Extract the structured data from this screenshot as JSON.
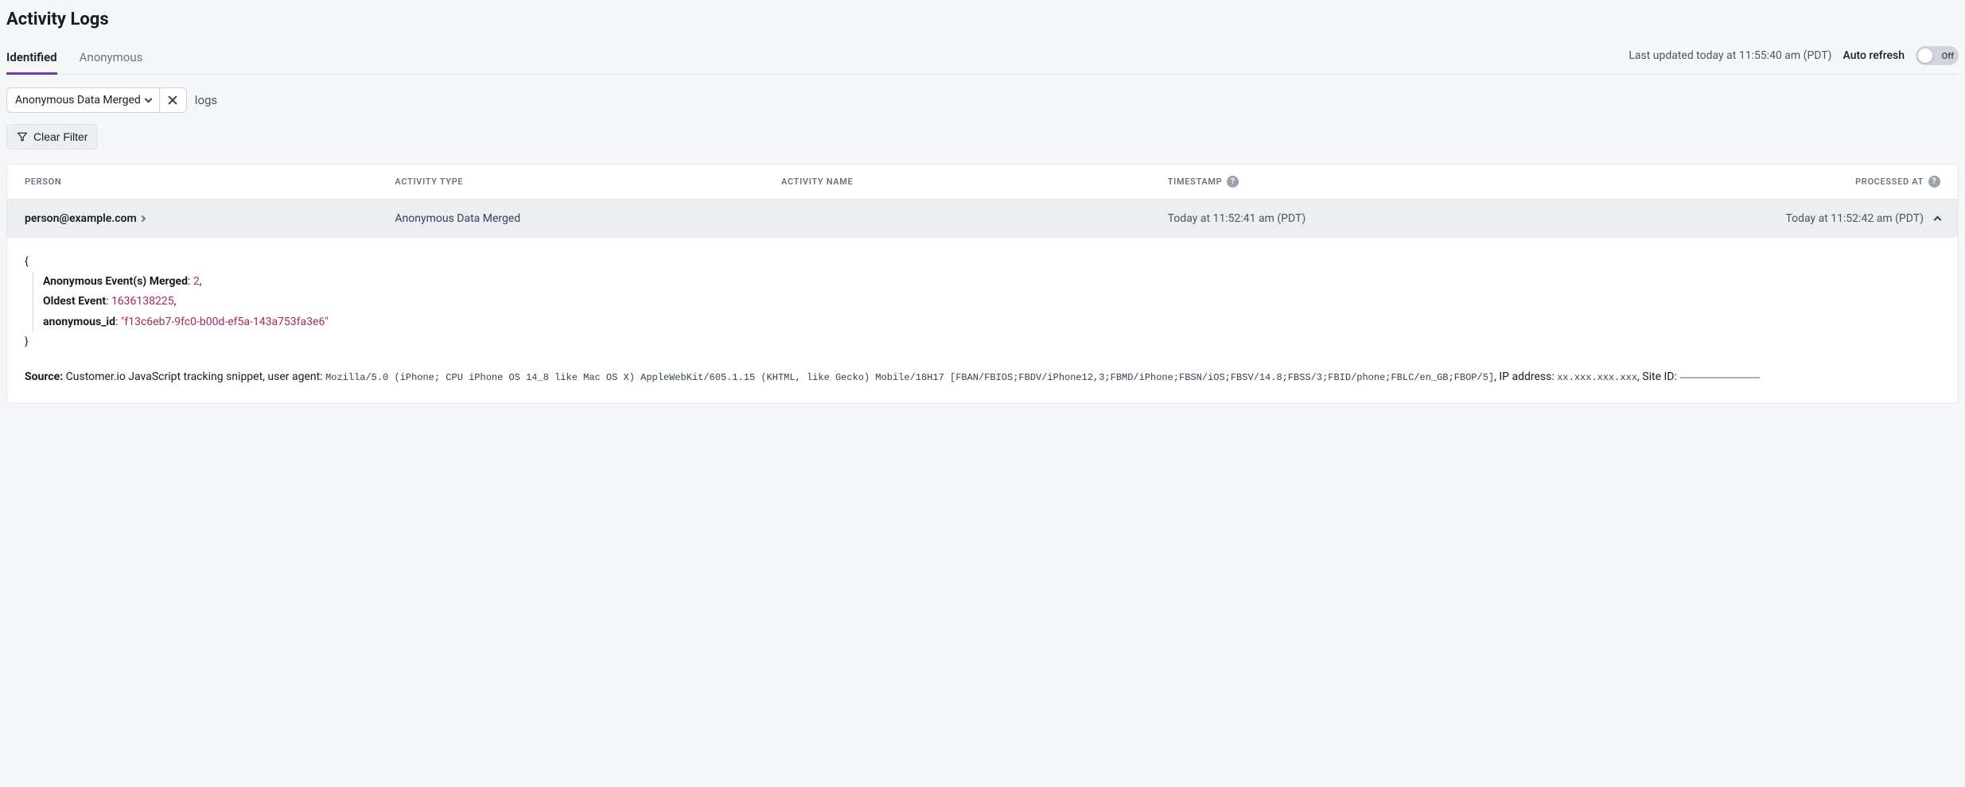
{
  "page_title": "Activity Logs",
  "tabs": [
    {
      "label": "Identified",
      "active": true
    },
    {
      "label": "Anonymous",
      "active": false
    }
  ],
  "last_updated": "Last updated today at 11:55:40 am (PDT)",
  "auto_refresh": {
    "label": "Auto refresh",
    "state_text": "Off",
    "on": false
  },
  "filter": {
    "chip_label": "Anonymous Data Merged",
    "trailing_text": "logs",
    "clear_label": "Clear Filter"
  },
  "table": {
    "columns": {
      "person": "PERSON",
      "activity_type": "ACTIVITY TYPE",
      "activity_name": "ACTIVITY NAME",
      "timestamp": "TIMESTAMP",
      "processed_at": "PROCESSED AT"
    },
    "row": {
      "person": "person@example.com",
      "activity_type": "Anonymous Data Merged",
      "activity_name": "",
      "timestamp": "Today at 11:52:41 am (PDT)",
      "processed_at": "Today at 11:52:42 am (PDT)"
    }
  },
  "detail": {
    "brace_open": "{",
    "brace_close": "}",
    "rows": [
      {
        "key": "Anonymous Event(s) Merged",
        "val": "2"
      },
      {
        "key": "Oldest Event",
        "val": "1636138225"
      },
      {
        "key": "anonymous_id",
        "val": "\"f13c6eb7-9fc0-b00d-ef5a-143a753fa3e6\""
      }
    ],
    "source_label": "Source:",
    "source_prefix": " Customer.io JavaScript tracking snippet, user agent: ",
    "user_agent": "Mozilla/5.0 (iPhone; CPU iPhone OS 14_8 like Mac OS X) AppleWebKit/605.1.15 (KHTML, like Gecko) Mobile/18H17 [FBAN/FBIOS;FBDV/iPhone12,3;FBMD/iPhone;FBSN/iOS;FBSV/14.8;FBSS/3;FBID/phone;FBLC/en_GB;FBOP/5]",
    "ip_label": ", IP address: ",
    "ip_value": "xx.xxx.xxx.xxx",
    "site_label": ", Site ID: ",
    "site_value": "——————————————"
  }
}
